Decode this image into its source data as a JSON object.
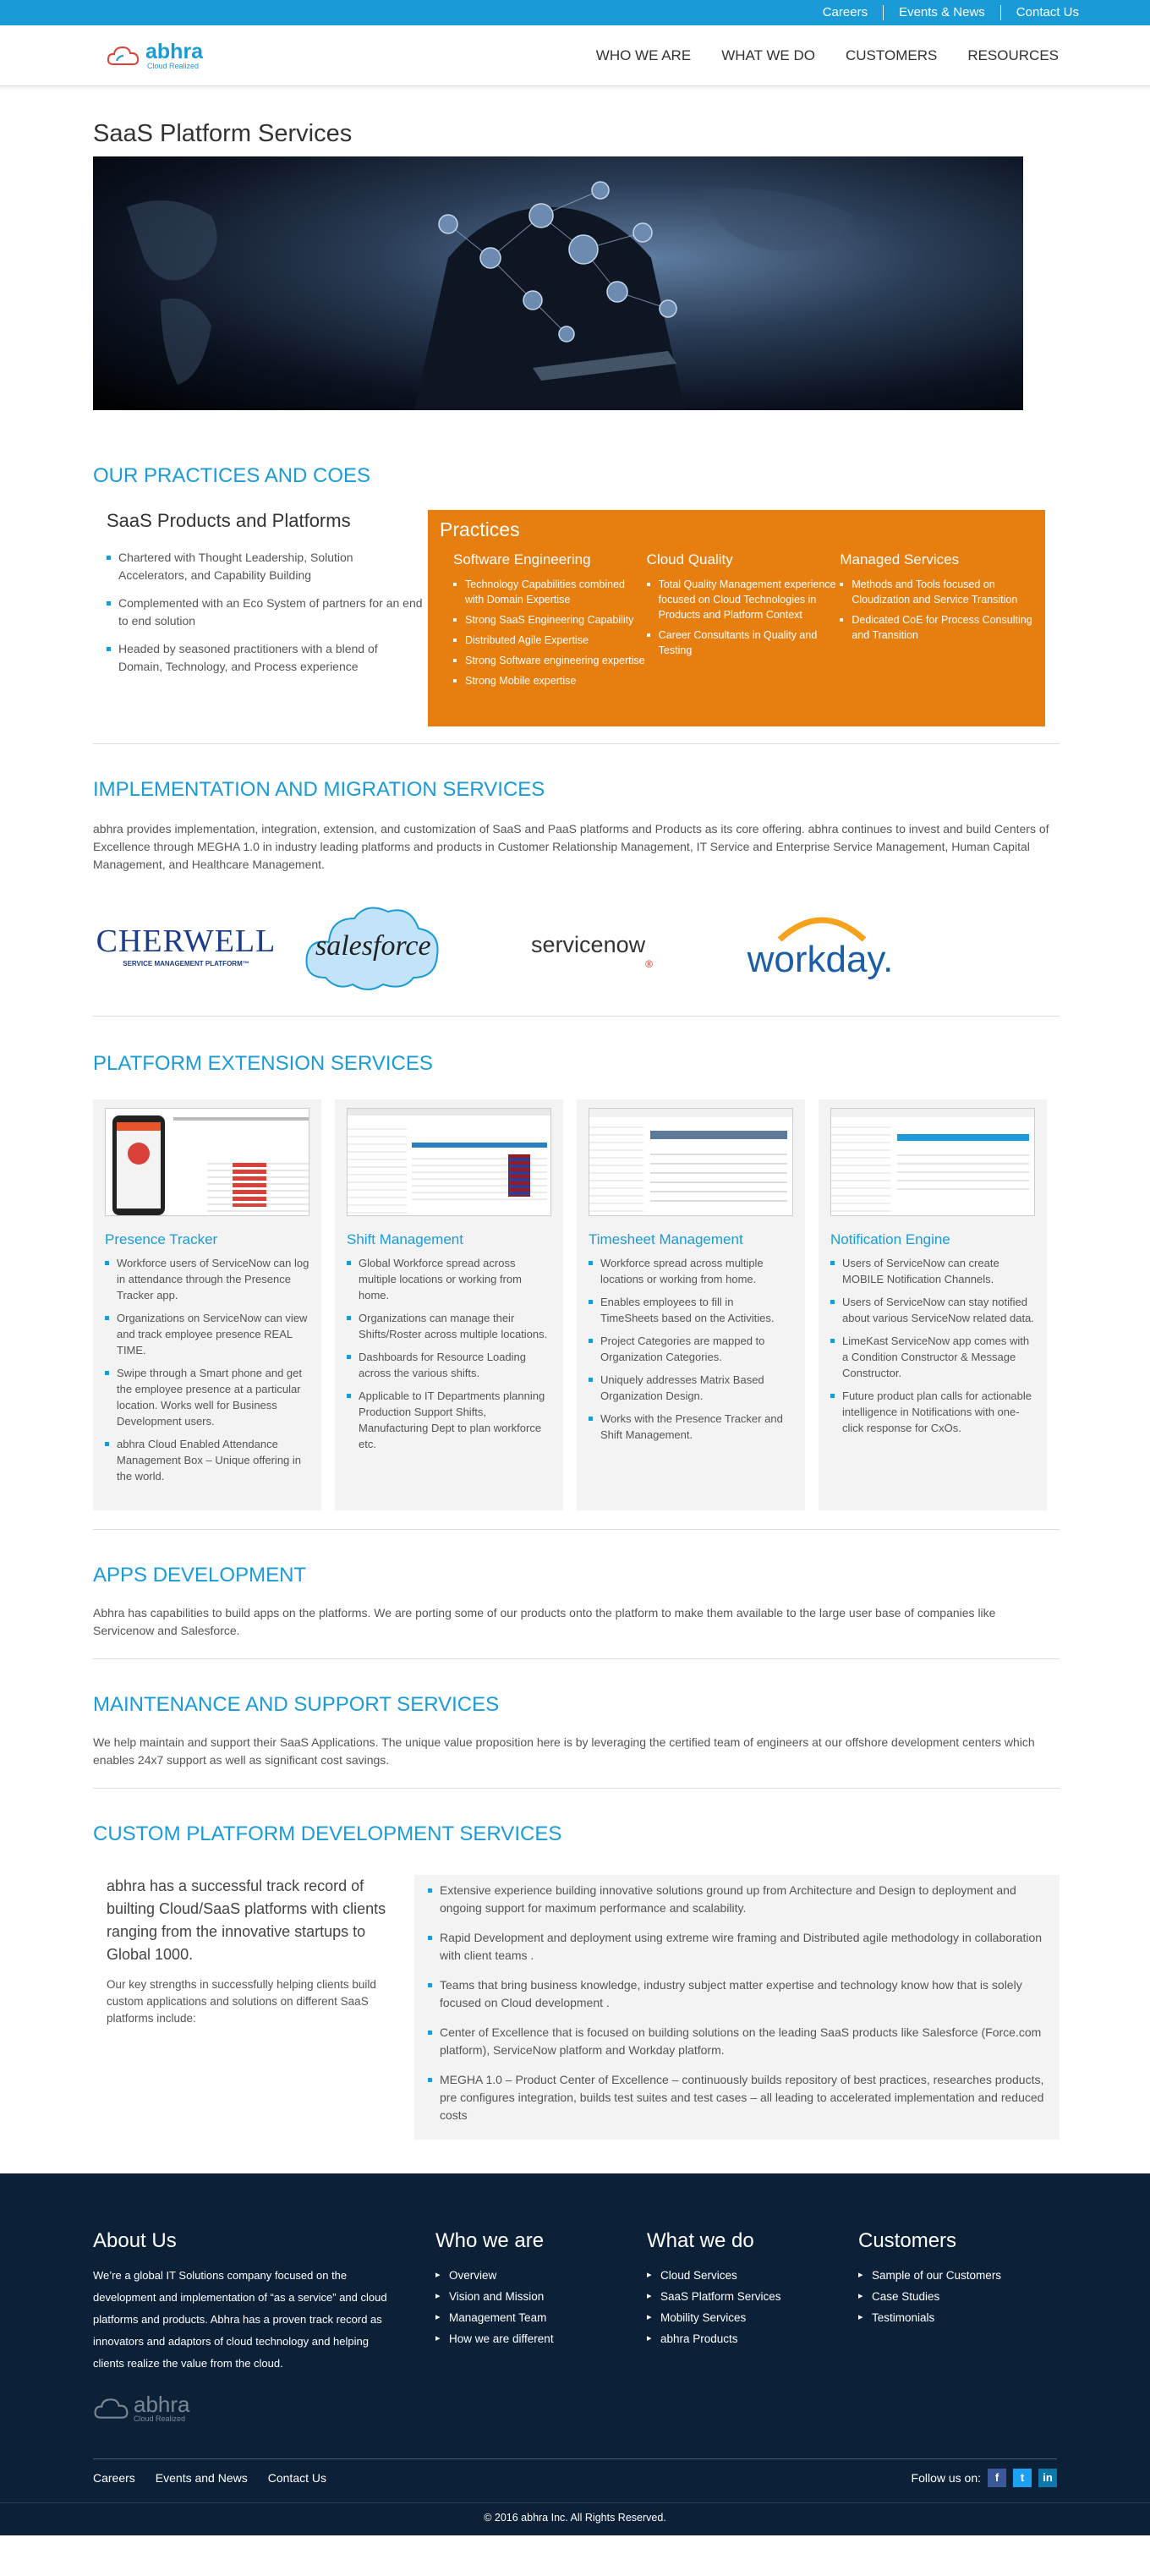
{
  "topbar": {
    "links": [
      "Careers",
      "Events & News",
      "Contact Us"
    ]
  },
  "brand": {
    "name": "abhra",
    "tagline": "Cloud Realized"
  },
  "nav": [
    "WHO WE ARE",
    "WHAT WE DO",
    "CUSTOMERS",
    "RESOURCES"
  ],
  "page_title": "SaaS Platform Services",
  "practices": {
    "title": "OUR PRACTICES AND COES",
    "left_heading": "SaaS Products and Platforms",
    "left_items": [
      "Chartered with Thought Leadership, Solution Accelerators, and Capability Building",
      "Complemented with an Eco System of partners for an end to end solution",
      "Headed by seasoned practitioners with a blend of Domain, Technology, and Process experience"
    ],
    "box_title": "Practices",
    "columns": [
      {
        "heading": "Software Engineering",
        "items": [
          "Technology Capabilities combined with Domain Expertise",
          "Strong SaaS Engineering Capability",
          "Distributed Agile Expertise",
          "Strong Software engineering expertise",
          "Strong Mobile expertise"
        ]
      },
      {
        "heading": "Cloud Quality",
        "items": [
          "Total Quality Management experience focused on Cloud Technologies in Products and Platform Context",
          "Career Consultants in Quality and Testing"
        ]
      },
      {
        "heading": "Managed Services",
        "items": [
          "Methods and Tools focused on Cloudization and Service Transition",
          "Dedicated CoE for Process Consulting and Transition"
        ]
      }
    ]
  },
  "implementation": {
    "title": "IMPLEMENTATION AND MIGRATION SERVICES",
    "text": "abhra provides implementation, integration, extension, and customization of SaaS and PaaS platforms and Products as its core offering. abhra continues to invest and build Centers of Excellence through MEGHA 1.0 in industry leading platforms and products in Customer Relationship Management, IT Service and Enterprise Service Management, Human Capital Management, and Healthcare Management.",
    "logos": {
      "cherwell": "CHERWELL",
      "cherwell_sub": "SERVICE MANAGEMENT PLATFORM™",
      "salesforce": "salesforce",
      "servicenow": "servicenow",
      "servicenow_mark": "®",
      "workday": "workday."
    }
  },
  "extension": {
    "title": "PLATFORM EXTENSION SERVICES",
    "cards": [
      {
        "title": "Presence Tracker",
        "items": [
          "Workforce users of ServiceNow can log in attendance through the Presence Tracker app.",
          "Organizations on ServiceNow can view and track employee presence REAL TIME.",
          "Swipe through a Smart phone and get the employee presence at a particular location. Works well for Business Development users.",
          "abhra Cloud Enabled Attendance Management Box – Unique offering in the world."
        ]
      },
      {
        "title": "Shift Management",
        "items": [
          "Global Workforce spread across multiple locations or working from home.",
          "Organizations can manage their Shifts/Roster across multiple locations.",
          "Dashboards for Resource Loading across the various shifts.",
          "Applicable to IT Departments planning Production Support Shifts, Manufacturing Dept to plan workforce etc."
        ]
      },
      {
        "title": "Timesheet Management",
        "items": [
          "Workforce spread across multiple locations or working from home.",
          "Enables employees to fill in TimeSheets based on the Activities.",
          "Project Categories are mapped to Organization Categories.",
          "Uniquely addresses Matrix Based Organization Design.",
          "Works with the Presence Tracker and Shift Management."
        ]
      },
      {
        "title": "Notification Engine",
        "items": [
          "Users of ServiceNow can create MOBILE Notification Channels.",
          "Users of ServiceNow can stay notified about various ServiceNow related data.",
          "LimeKast ServiceNow app comes with a Condition Constructor & Message Constructor.",
          "Future product plan calls for actionable intelligence in Notifications with one-click response for CxOs."
        ]
      }
    ]
  },
  "apps": {
    "title": "APPS DEVELOPMENT",
    "text": "Abhra has capabilities to build apps on the platforms. We are porting some of our products onto the platform to make them available to the large user base of companies like Servicenow and Salesforce."
  },
  "maintenance": {
    "title": "MAINTENANCE AND SUPPORT SERVICES",
    "text": "We help maintain and support their SaaS Applications. The unique value proposition here is by leveraging the certified team of engineers at our offshore development centers which enables 24x7 support as well as significant cost savings."
  },
  "custom": {
    "title": "CUSTOM PLATFORM DEVELOPMENT SERVICES",
    "lead": "abhra has a successful track record of builting Cloud/SaaS platforms with clients ranging from the innovative startups to Global 1000.",
    "sub": "Our key strengths in successfully helping clients build custom applications and solutions on different SaaS platforms include:",
    "items": [
      "Extensive experience building innovative solutions ground up from Architecture and Design to deployment and ongoing support for maximum performance and scalability.",
      "Rapid Development and deployment using extreme wire framing and Distributed agile methodology in collaboration with client teams .",
      "Teams that bring business knowledge, industry subject matter expertise and technology know how that is solely focused on Cloud development .",
      "Center of Excellence that is focused on building solutions on the leading SaaS products like Salesforce (Force.com platform), ServiceNow platform and Workday platform.",
      "MEGHA 1.0 – Product Center of Excellence – continuously builds repository of best practices, researches products, pre configures integration, builds test suites and test cases – all leading to accelerated implementation and reduced costs"
    ]
  },
  "footer": {
    "about_title": "About Us",
    "about_text": "We’re a global IT Solutions company focused on the development and implementation of “as a service” and cloud platforms and products. Abhra has a proven track record as innovators and adaptors of cloud technology and helping clients realize the value from the cloud.",
    "columns": [
      {
        "title": "Who we are",
        "items": [
          "Overview",
          "Vision and Mission",
          "Management Team",
          "How we are different"
        ]
      },
      {
        "title": "What we do",
        "items": [
          "Cloud Services",
          "SaaS Platform Services",
          "Mobility Services",
          "abhra Products"
        ]
      },
      {
        "title": "Customers",
        "items": [
          "Sample of our Customers",
          "Case Studies",
          "Testimonials"
        ]
      }
    ],
    "bottom_links": [
      "Careers",
      "Events and News",
      "Contact Us"
    ],
    "follow": "Follow us on:",
    "social": [
      "f",
      "t",
      "in"
    ],
    "copyright": "© 2016 abhra Inc. All Rights Reserved."
  },
  "colors": {
    "accent": "#1a9bd7",
    "orange": "#e67e10",
    "footer": "#0c2138"
  }
}
